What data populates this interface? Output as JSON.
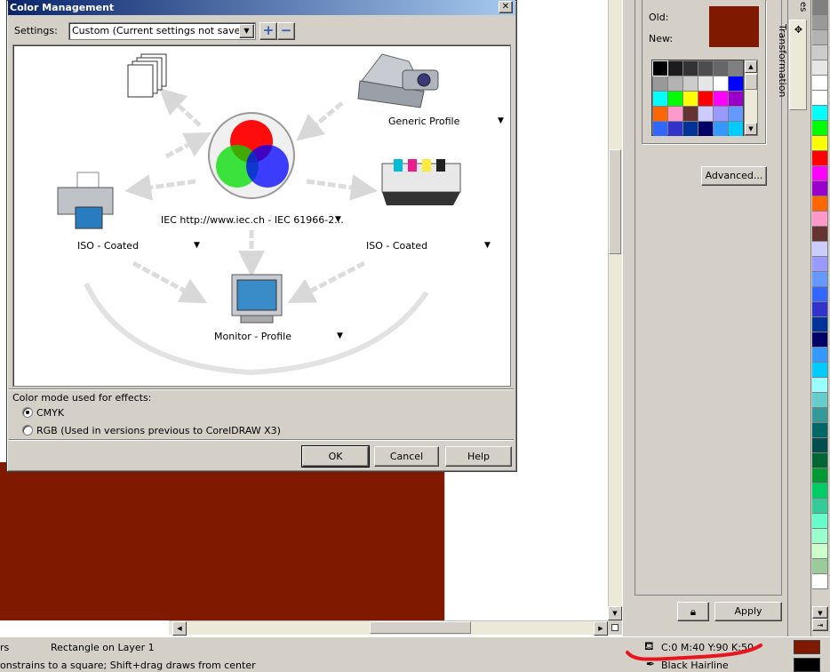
{
  "dialog": {
    "title": "Color Management",
    "settings_label": "Settings:",
    "settings_value": "Custom (Current settings not saved)",
    "devices": {
      "scanner_profile": "Generic Profile",
      "internal_rgb": "IEC http://www.iec.ch - IEC 61966-2...",
      "composite_printer": "ISO - Coated",
      "separations_printer": "ISO - Coated",
      "monitor": "Monitor - Profile"
    },
    "color_mode_label": "Color mode used for effects:",
    "mode_options": [
      "CMYK",
      "RGB (Used in versions previous to CorelDRAW X3)"
    ],
    "selected_mode": "CMYK",
    "buttons": {
      "ok": "OK",
      "cancel": "Cancel",
      "help": "Help"
    }
  },
  "docker": {
    "old_label": "Old:",
    "new_label": "New:",
    "old_color": "#7f1a00",
    "new_color": "#7f1a00",
    "palette": [
      "#000000",
      "#1c1c1c",
      "#333333",
      "#4d4d4d",
      "#666666",
      "#808080",
      "#999999",
      "#b3b3b3",
      "#cccccc",
      "#e6e6e6",
      "#ffffff",
      "#0000ff",
      "#00ffff",
      "#00ff00",
      "#ffff00",
      "#ff0000",
      "#ff00ff",
      "#9900cc",
      "#ff6600",
      "#ff99cc",
      "#663333",
      "#ccccff",
      "#9999ff",
      "#6699ff",
      "#3366ff",
      "#3333cc",
      "#003399",
      "#000066",
      "#3399ff",
      "#00ccff"
    ],
    "advanced_label": "Advanced...",
    "apply_label": "Apply",
    "tabs": {
      "transformation": "Transformation",
      "previous_tab_fragment": "es"
    }
  },
  "color_strip": [
    "#808080",
    "#999999",
    "#b3b3b3",
    "#cccccc",
    "#e6e6e6",
    "#ffffff",
    "#ffffff",
    "#00ffff",
    "#00ff00",
    "#ffff00",
    "#ff0000",
    "#ff00ff",
    "#9900cc",
    "#ff6600",
    "#ff99cc",
    "#663333",
    "#ccccff",
    "#9999ff",
    "#6699ff",
    "#3366ff",
    "#3333cc",
    "#003399",
    "#000066",
    "#3399ff",
    "#00ccff",
    "#99ffff",
    "#66cccc",
    "#339999",
    "#006666",
    "#004d4d",
    "#006633",
    "#009933",
    "#00cc66",
    "#33cc99",
    "#66ffcc",
    "#99ffcc",
    "#ccffcc",
    "#99cc99",
    "#ffffff"
  ],
  "status": {
    "line1_left": "rs",
    "object_info": "Rectangle on Layer 1",
    "hint": "onstrains to a square; Shift+drag draws from center",
    "fill_info": "C:0 M:40 Y:90 K:50",
    "outline_info": "Black  Hairline",
    "fill_color": "#7f1a00",
    "outline_color": "#000000",
    "annotation_color": "#e8141e"
  },
  "icons": {
    "close": "close-icon",
    "dropdown": "chevron-down-icon",
    "add": "plus-icon",
    "remove": "minus-icon",
    "lock": "lock-icon",
    "fill": "fill-bucket-icon",
    "outline": "pen-nib-icon",
    "transform": "transform-icon"
  }
}
